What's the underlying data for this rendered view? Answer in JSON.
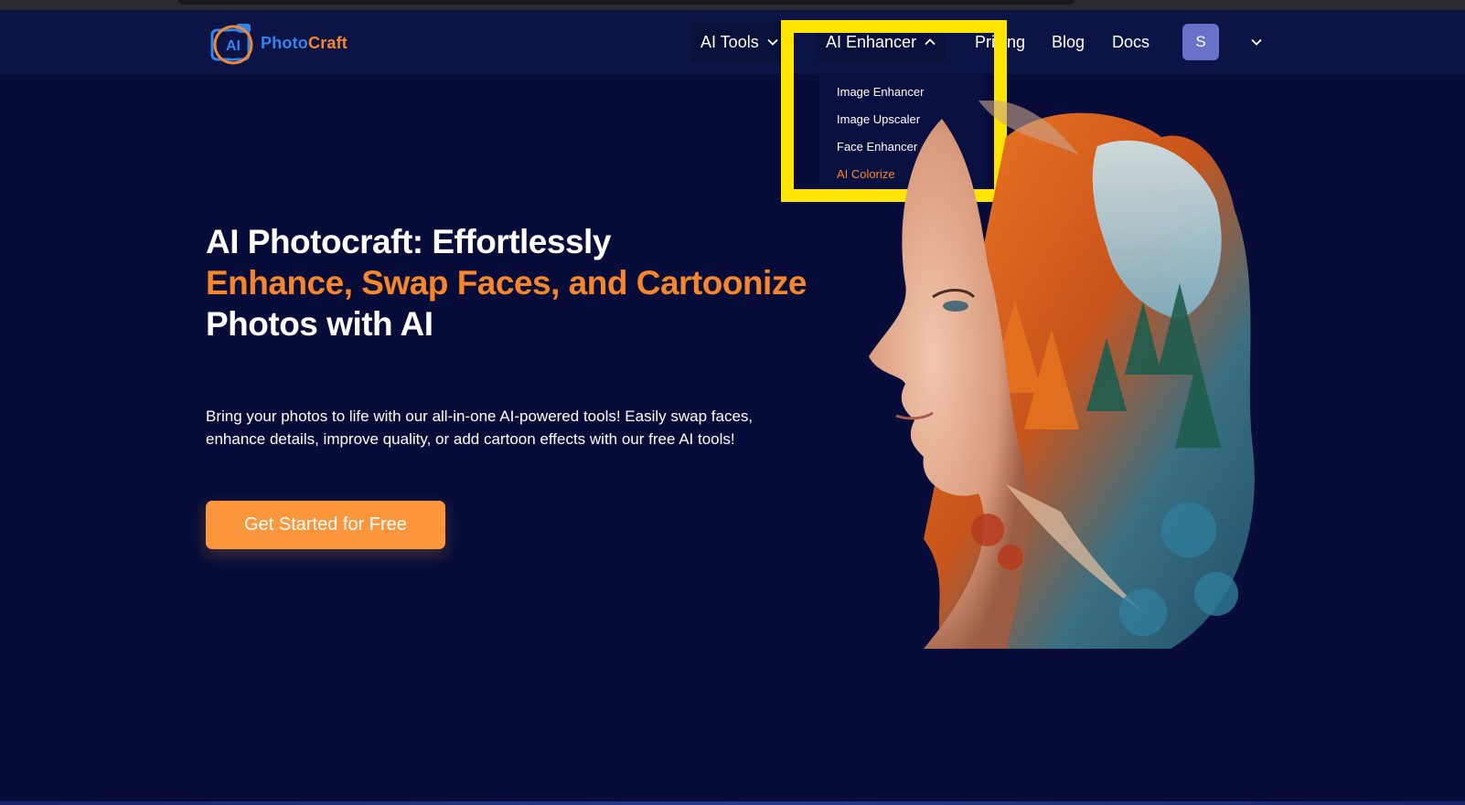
{
  "brand": {
    "logo_badge": "AI",
    "name_part1": "Photo",
    "name_part2": "Craft",
    "accent_color": "#f5862c",
    "blue_color": "#2f86ef"
  },
  "nav": {
    "ai_tools": "AI Tools",
    "ai_enhancer": "AI Enhancer",
    "pricing": "Pricing",
    "blog": "Blog",
    "docs": "Docs",
    "avatar_initial": "S",
    "icons": {
      "ai_tools_chevron": "chevron-down-icon",
      "ai_enhancer_chevron": "chevron-up-icon",
      "user_menu_chevron": "chevron-down-icon"
    }
  },
  "dropdown": {
    "items": [
      {
        "label": "Image Enhancer"
      },
      {
        "label": "Image Upscaler"
      },
      {
        "label": "Face Enhancer"
      },
      {
        "label": "AI Colorize"
      }
    ]
  },
  "hero": {
    "title_line1": "AI Photocraft: Effortlessly",
    "title_line2": "Enhance, Swap Faces, and Cartoonize",
    "title_line3": "Photos with AI",
    "description": "Bring your photos to life with our all-in-one AI-powered tools! Easily swap faces, enhance details, improve quality, or add cartoon effects with our free AI tools!",
    "cta_label": "Get Started for Free"
  },
  "colors": {
    "background": "#070d38",
    "navbar": "#0b1444",
    "highlight": "#ffe500",
    "cta": "#fb963d"
  }
}
